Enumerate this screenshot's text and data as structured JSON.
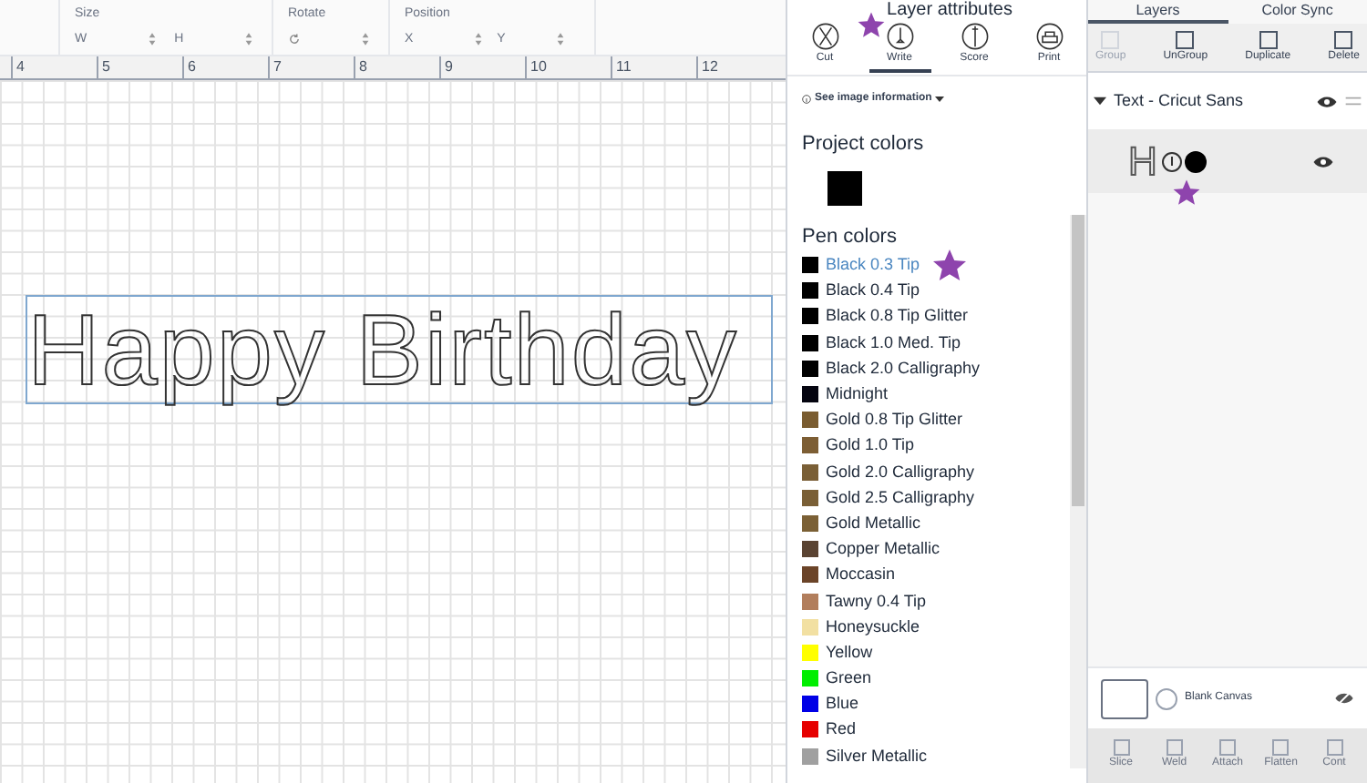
{
  "toolbar": {
    "size_label": "Size",
    "w_label": "W",
    "h_label": "H",
    "rotate_label": "Rotate",
    "position_label": "Position",
    "x_label": "X",
    "y_label": "Y"
  },
  "ruler": [
    "4",
    "5",
    "6",
    "7",
    "8",
    "9",
    "10",
    "11",
    "12"
  ],
  "canvas": {
    "text": "Happy Birthday"
  },
  "attributes": {
    "title": "Layer attributes",
    "tabs": [
      {
        "label": "Cut",
        "selected": false
      },
      {
        "label": "Write",
        "selected": true
      },
      {
        "label": "Score",
        "selected": false
      },
      {
        "label": "Print",
        "selected": false
      }
    ],
    "info": "See image information",
    "project_colors_title": "Project colors",
    "project_colors": [
      {
        "color": "#000000"
      }
    ],
    "pen_colors_title": "Pen colors",
    "pen_colors": [
      {
        "name": "Black 0.3 Tip",
        "color": "#000000",
        "selected": true
      },
      {
        "name": "Black 0.4 Tip",
        "color": "#000000",
        "selected": false
      },
      {
        "name": "Black 0.8 Tip Glitter",
        "color": "#000000",
        "selected": false
      },
      {
        "name": "Black 1.0 Med. Tip",
        "color": "#000000",
        "selected": false
      },
      {
        "name": "Black 2.0 Calligraphy",
        "color": "#000000",
        "selected": false
      },
      {
        "name": "Midnight",
        "color": "#050510",
        "selected": false
      },
      {
        "name": "Gold 0.8 Tip Glitter",
        "color": "#7a5c30",
        "selected": false
      },
      {
        "name": "Gold 1.0 Tip",
        "color": "#7d5e34",
        "selected": false
      },
      {
        "name": "Gold 2.0 Calligraphy",
        "color": "#7a5f36",
        "selected": false
      },
      {
        "name": "Gold 2.5 Calligraphy",
        "color": "#7a5f36",
        "selected": false
      },
      {
        "name": "Gold Metallic",
        "color": "#7b6035",
        "selected": false
      },
      {
        "name": "Copper Metallic",
        "color": "#5a4332",
        "selected": false
      },
      {
        "name": "Moccasin",
        "color": "#6b4428",
        "selected": false
      },
      {
        "name": "Tawny 0.4 Tip",
        "color": "#b27e5c",
        "selected": false
      },
      {
        "name": "Honeysuckle",
        "color": "#f2e0a2",
        "selected": false
      },
      {
        "name": "Yellow",
        "color": "#ffff00",
        "selected": false
      },
      {
        "name": "Green",
        "color": "#00ee00",
        "selected": false
      },
      {
        "name": "Blue",
        "color": "#0000e6",
        "selected": false
      },
      {
        "name": "Red",
        "color": "#e60000",
        "selected": false
      },
      {
        "name": "Silver Metallic",
        "color": "#a0a0a0",
        "selected": false
      }
    ]
  },
  "layers": {
    "tabs": [
      {
        "label": "Layers",
        "selected": true
      },
      {
        "label": "Color Sync",
        "selected": false
      }
    ],
    "actions": [
      {
        "label": "Group",
        "disabled": true
      },
      {
        "label": "UnGroup",
        "disabled": false
      },
      {
        "label": "Duplicate",
        "disabled": false
      },
      {
        "label": "Delete",
        "disabled": false
      }
    ],
    "group": {
      "name": "Text - Cricut Sans",
      "expanded": true,
      "children": [
        {
          "glyph": "H",
          "color": "#000000"
        }
      ]
    },
    "blank_canvas": "Blank Canvas",
    "bottom_actions": [
      {
        "label": "Slice"
      },
      {
        "label": "Weld"
      },
      {
        "label": "Attach"
      },
      {
        "label": "Flatten"
      },
      {
        "label": "Cont"
      }
    ]
  }
}
